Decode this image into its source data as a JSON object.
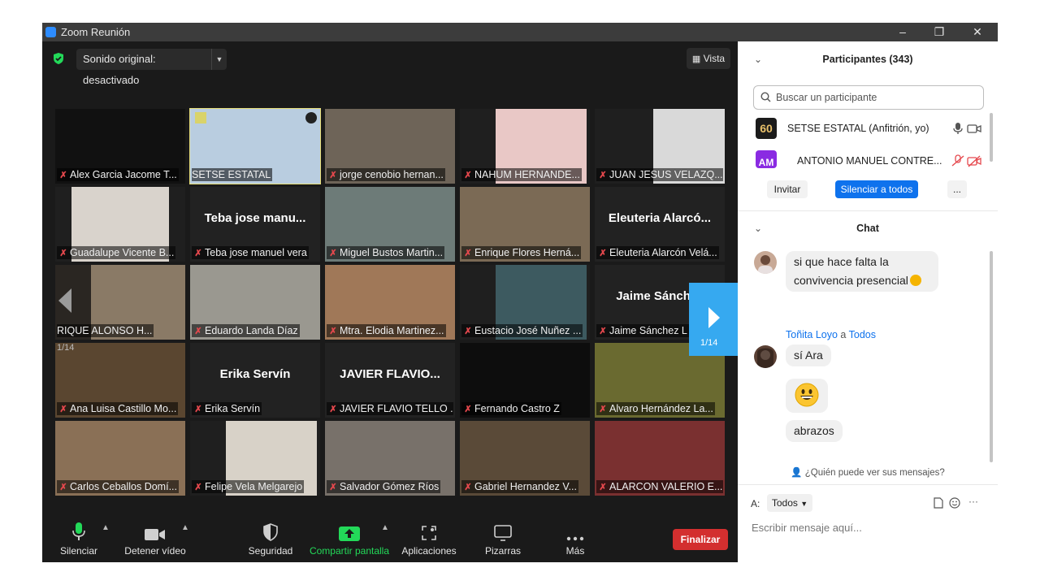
{
  "window": {
    "title": "Zoom Reunión",
    "controls": [
      "–",
      "❐",
      "✕"
    ]
  },
  "meeting": {
    "sound_button": "Sonido original: desactivado",
    "view_button": "Vista",
    "page_left": "1/14",
    "page_right": "1/14",
    "tiles": [
      {
        "label": "Alex Garcia Jacome T...",
        "muted": true,
        "bg": "#0d0d0d",
        "video": "#111111"
      },
      {
        "label": "SETSE ESTATAL",
        "muted": false,
        "bg": "#d9e7f3",
        "video": "#b9cde0",
        "active": true
      },
      {
        "label": "jorge cenobio hernan...",
        "muted": true,
        "bg": "#587a62",
        "video": "#6e6458"
      },
      {
        "label": "NAHUM HERNANDE...",
        "muted": true,
        "bg": "#1f1f1f",
        "video": "#e9c8c6"
      },
      {
        "label": "JUAN JESUS VELAZQ...",
        "muted": true,
        "bg": "#1f1f1f",
        "video": "#d9d9d9"
      },
      {
        "label": "Guadalupe Vicente B...",
        "muted": true,
        "bg": "#1f1f1f",
        "video": "#d9d3cc"
      },
      {
        "label": "Teba jose manuel vera",
        "muted": true,
        "bg": "#222222",
        "bigname": "Teba jose manu..."
      },
      {
        "label": "Miguel Bustos Martin...",
        "muted": true,
        "bg": "#7a8a86",
        "video": "#6d7b78"
      },
      {
        "label": "Enrique Flores Herná...",
        "muted": true,
        "bg": "#6a5b4a",
        "video": "#7b6a55"
      },
      {
        "label": "Eleuteria Alarcón Velá...",
        "muted": true,
        "bg": "#222222",
        "bigname": "Eleuteria  Alarcó..."
      },
      {
        "label": "RIQUE ALONSO H...",
        "muted": false,
        "bg": "#2a2622",
        "video": "#8a7a66"
      },
      {
        "label": "Eduardo Landa Díaz",
        "muted": true,
        "bg": "#8c8a80",
        "video": "#9a9890"
      },
      {
        "label": "Mtra. Elodia Martinez...",
        "muted": true,
        "bg": "#8a6a52",
        "video": "#a07858"
      },
      {
        "label": "Eustacio José Nuñez ...",
        "muted": true,
        "bg": "#1f1f1f",
        "video": "#3d5a60"
      },
      {
        "label": "Jaime Sánchez L",
        "muted": true,
        "bg": "#222222",
        "bigname": "Jaime Sánchez"
      },
      {
        "label": "Ana Luisa Castillo Mo...",
        "muted": true,
        "bg": "#2a2218",
        "video": "#5a4630"
      },
      {
        "label": "Erika Servín",
        "muted": true,
        "bg": "#222222",
        "bigname": "Erika Servín"
      },
      {
        "label": "JAVIER FLAVIO TELLO ...",
        "muted": true,
        "bg": "#222222",
        "bigname": "JAVIER FLAVIO..."
      },
      {
        "label": "Fernando Castro Z",
        "muted": true,
        "bg": "#0d0d0d",
        "video": "#0d0d0d"
      },
      {
        "label": "Alvaro Hernández La...",
        "muted": true,
        "bg": "#8a8a3a",
        "video": "#6a6a30"
      },
      {
        "label": "Carlos Ceballos Domí...",
        "muted": true,
        "bg": "#7a6048",
        "video": "#8a7056"
      },
      {
        "label": "Felipe Vela Melgarejo",
        "muted": true,
        "bg": "#1f1f1f",
        "video": "#d8d2c8"
      },
      {
        "label": "Salvador Gómez Ríos",
        "muted": true,
        "bg": "#6a6a6a",
        "video": "#78716a"
      },
      {
        "label": "Gabriel Hernandez V...",
        "muted": true,
        "bg": "#3a3024",
        "video": "#5a4a38"
      },
      {
        "label": "ALARCON VALERIO E...",
        "muted": true,
        "bg": "#6a2222",
        "video": "#7a3030"
      }
    ]
  },
  "toolbar": {
    "mute": "Silenciar",
    "video": "Detener vídeo",
    "security": "Seguridad",
    "share": "Compartir pantalla",
    "apps": "Aplicaciones",
    "whiteboards": "Pizarras",
    "more": "Más",
    "end": "Finalizar",
    "share_color": "#23d959",
    "end_color": "#d32f2f"
  },
  "participants": {
    "header": "Participantes (343)",
    "search_placeholder": "Buscar un participante",
    "list": [
      {
        "name": "SETSE ESTATAL (Anfitrión, yo)",
        "avatar_text": "60"
      },
      {
        "name": "ANTONIO MANUEL CONTRE...",
        "avatar_text": "AM"
      }
    ],
    "invite": "Invitar",
    "mute_all": "Silenciar a todos",
    "more": "..."
  },
  "chat": {
    "header": "Chat",
    "messages": [
      {
        "text1": "si que hace falta la",
        "text2": "convivencia presencial"
      },
      {
        "sender": "Toñita Loyo",
        "sep": "a",
        "recipient": "Todos",
        "text": "sí Ara"
      },
      {
        "emoji": "😀"
      },
      {
        "text": "abrazos"
      }
    ],
    "who_sees": "¿Quién puede ver sus mensajes?",
    "to_label": "A:",
    "to_value": "Todos",
    "input_placeholder": "Escribir mensaje aquí..."
  }
}
